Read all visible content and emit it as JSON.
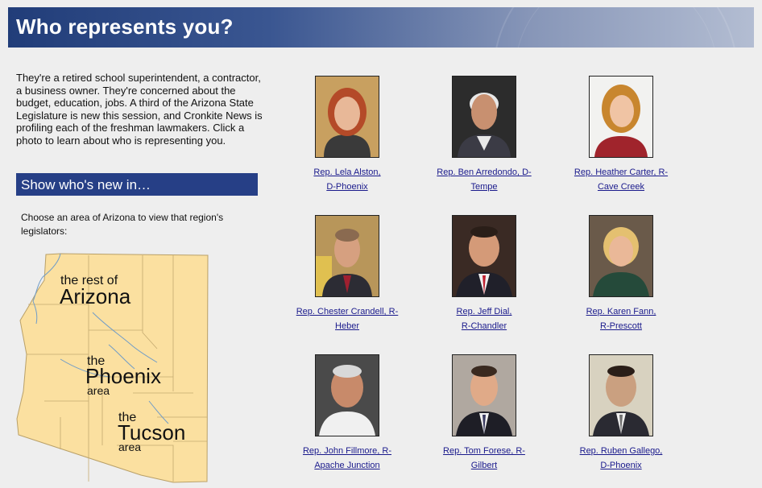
{
  "header": {
    "title": "Who represents you?"
  },
  "intro": {
    "text": "They're a retired school superintendent, a contractor, a business owner. They're concerned about the budget, education, jobs. A third of the Arizona State Legislature is new this session, and Cronkite News is profiling each of the freshman lawmakers. Click a photo to learn about who is representing you."
  },
  "filter": {
    "title": "Show who's new in…",
    "instructions": "Choose an area of Arizona to view that region's legislators:"
  },
  "map": {
    "regions": [
      {
        "small": "the rest of",
        "big": "Arizona",
        "area": ""
      },
      {
        "small": "the",
        "big": "Phoenix",
        "area": "area"
      },
      {
        "small": "the",
        "big": "Tucson",
        "area": "area"
      }
    ],
    "colors": {
      "land": "#fbe0a0",
      "border": "#b9a068",
      "water": "#6f9cc8"
    }
  },
  "legislators": [
    {
      "line1": "Rep. Lela Alston,",
      "line2": "D-Phoenix"
    },
    {
      "line1": "Rep. Ben Arredondo, D-",
      "line2": "Tempe"
    },
    {
      "line1": "Rep. Heather Carter, R-",
      "line2": "Cave Creek"
    },
    {
      "line1": "Rep. Chester Crandell, R-",
      "line2": "Heber"
    },
    {
      "line1": "Rep. Jeff Dial,",
      "line2": "R-Chandler"
    },
    {
      "line1": "Rep. Karen Fann,",
      "line2": "R-Prescott"
    },
    {
      "line1": "Rep. John Fillmore, R-",
      "line2": "Apache Junction"
    },
    {
      "line1": "Rep. Tom Forese, R-",
      "line2": "Gilbert"
    },
    {
      "line1": "Rep. Ruben Gallego,",
      "line2": "D-Phoenix"
    }
  ]
}
